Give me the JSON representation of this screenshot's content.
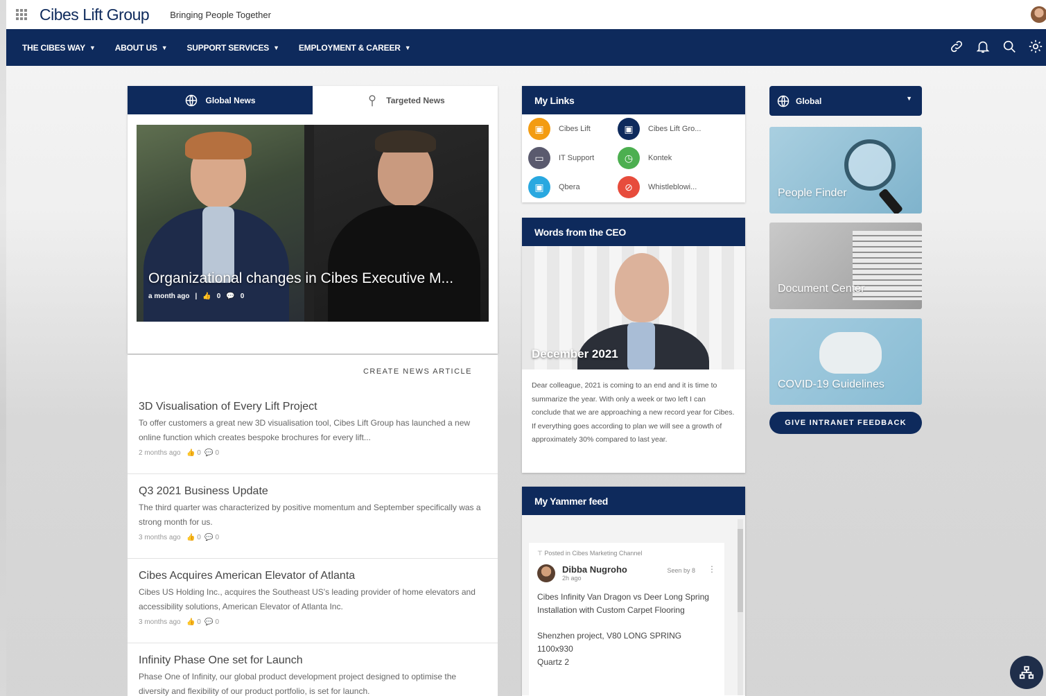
{
  "header": {
    "logo": "Cibes Lift Group",
    "tagline": "Bringing People Together"
  },
  "nav": {
    "items": [
      {
        "label": "THE CIBES WAY"
      },
      {
        "label": "ABOUT US"
      },
      {
        "label": "SUPPORT SERVICES"
      },
      {
        "label": "EMPLOYMENT & CAREER"
      }
    ]
  },
  "news": {
    "tabs": [
      {
        "label": "Global News",
        "active": true
      },
      {
        "label": "Targeted News",
        "active": false
      }
    ],
    "hero": {
      "title": "Organizational changes in Cibes Executive M...",
      "time": "a month ago",
      "likes": "0",
      "comments": "0"
    },
    "create_label": "CREATE NEWS ARTICLE",
    "items": [
      {
        "title": "3D Visualisation of Every Lift Project",
        "desc": "To offer customers a great new 3D visualisation tool, Cibes Lift Group has launched a new online function which creates bespoke brochures for every lift...",
        "time": "2 months ago",
        "likes": "0",
        "comments": "0"
      },
      {
        "title": "Q3 2021 Business Update",
        "desc": "The third quarter was characterized by positive momentum and September specifically was a strong month for us.",
        "time": "3 months ago",
        "likes": "0",
        "comments": "0"
      },
      {
        "title": "Cibes Acquires American Elevator of Atlanta",
        "desc": "Cibes US Holding Inc., acquires the Southeast US's leading provider of home elevators and accessibility solutions, American Elevator of Atlanta Inc.",
        "time": "3 months ago",
        "likes": "0",
        "comments": "0"
      },
      {
        "title": "Infinity Phase One set for Launch",
        "desc": "Phase One of Infinity, our global product development project designed to optimise the diversity and flexibility of our product portfolio, is set for launch.",
        "time": "",
        "likes": "",
        "comments": ""
      }
    ]
  },
  "my_links": {
    "title": "My Links",
    "links": [
      {
        "label": "Cibes Lift",
        "color": "#f39c12",
        "icon": "calendar-icon"
      },
      {
        "label": "Cibes Lift Gro...",
        "color": "#0e2a5c",
        "icon": "calendar-icon"
      },
      {
        "label": "IT Support",
        "color": "#5a5a6e",
        "icon": "monitor-icon"
      },
      {
        "label": "Kontek",
        "color": "#4caf50",
        "icon": "clock-icon"
      },
      {
        "label": "Qbera",
        "color": "#29a8e0",
        "icon": "image-icon"
      },
      {
        "label": "Whistleblowi...",
        "color": "#e74c3c",
        "icon": "link-icon"
      }
    ]
  },
  "ceo": {
    "title": "Words from the CEO",
    "caption": "December 2021",
    "text": "Dear colleague, 2021 is coming to an end and it is time to summarize the year. With only a week or two left I can conclude that we are approaching a new record year for Cibes. If everything goes according to plan we will see a growth of approximately 30% compared to last year."
  },
  "yammer": {
    "title": "My Yammer feed",
    "posted_in": "Posted in Cibes Marketing Channel",
    "author": "Dibba Nugroho",
    "time": "2h ago",
    "seen": "Seen by 8",
    "text1": "Cibes Infinity Van Dragon vs Deer Long Spring Installation with Custom Carpet Flooring",
    "text2": "Shenzhen project, V80 LONG SPRING 1100x930",
    "text3": "Quartz 2"
  },
  "sidebar": {
    "dropdown_label": "Global",
    "tiles": [
      {
        "label": "People Finder"
      },
      {
        "label": "Document Center"
      },
      {
        "label": "COVID-19 Guidelines"
      }
    ],
    "feedback_label": "GIVE INTRANET FEEDBACK"
  }
}
